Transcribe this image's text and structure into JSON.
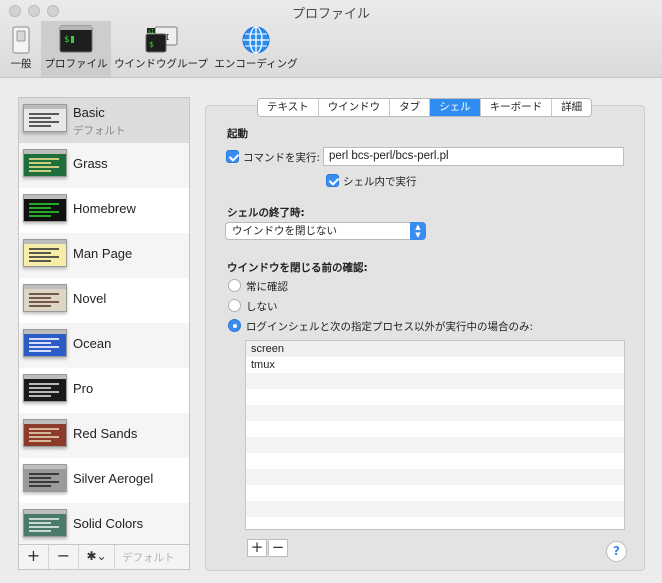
{
  "window": {
    "title": "プロファイル"
  },
  "toolbar": {
    "items": [
      {
        "label": "一般",
        "icon": "switch-icon",
        "selected": false
      },
      {
        "label": "プロファイル",
        "icon": "terminal-icon",
        "selected": true
      },
      {
        "label": "ウインドウグループ",
        "icon": "window-group-icon",
        "selected": false
      },
      {
        "label": "エンコーディング",
        "icon": "globe-icon",
        "selected": false
      }
    ]
  },
  "profiles": {
    "items": [
      {
        "name": "Basic",
        "subtitle": "デフォルト",
        "selected": true,
        "bg": "#e8e8e8",
        "fg": "#333333"
      },
      {
        "name": "Grass",
        "bg": "#1f6f3c",
        "fg": "#f1e38f"
      },
      {
        "name": "Homebrew",
        "bg": "#111111",
        "fg": "#28d02c"
      },
      {
        "name": "Man Page",
        "bg": "#f6eea8",
        "fg": "#333333"
      },
      {
        "name": "Novel",
        "bg": "#ddd6c4",
        "fg": "#5a3a2a"
      },
      {
        "name": "Ocean",
        "bg": "#2c5cc8",
        "fg": "#ffffff"
      },
      {
        "name": "Pro",
        "bg": "#1a1a1a",
        "fg": "#e0e0e0"
      },
      {
        "name": "Red Sands",
        "bg": "#8e3a2a",
        "fg": "#e8d7b0"
      },
      {
        "name": "Silver Aerogel",
        "bg": "#9a9a9a",
        "fg": "#222222"
      },
      {
        "name": "Solid Colors",
        "bg": "#4a7a6a",
        "fg": "#e6f0ea"
      }
    ],
    "footer": {
      "add_label": "+",
      "remove_label": "−",
      "gear_label": "✱⌄",
      "default_label": "デフォルト"
    }
  },
  "tabs": {
    "items": [
      {
        "label": "テキスト",
        "active": false
      },
      {
        "label": "ウインドウ",
        "active": false
      },
      {
        "label": "タブ",
        "active": false
      },
      {
        "label": "シェル",
        "active": true
      },
      {
        "label": "キーボード",
        "active": false
      },
      {
        "label": "詳細",
        "active": false
      }
    ]
  },
  "shell": {
    "startup": {
      "heading": "起動",
      "run_command_label": "コマンドを実行:",
      "run_command_checked": true,
      "command_value": "perl bcs-perl/bcs-perl.pl",
      "run_in_shell_label": "シェル内で実行",
      "run_in_shell_checked": true
    },
    "on_exit": {
      "heading": "シェルの終了時:",
      "selected": "ウインドウを閉じない"
    },
    "confirm": {
      "heading": "ウインドウを閉じる前の確認:",
      "options": [
        {
          "label": "常に確認",
          "selected": false
        },
        {
          "label": "しない",
          "selected": false
        },
        {
          "label": "ログインシェルと次の指定プロセス以外が実行中の場合のみ:",
          "selected": true
        }
      ],
      "processes": [
        "screen",
        "tmux"
      ],
      "add_label": "+",
      "remove_label": "−"
    },
    "help_label": "?"
  },
  "colors": {
    "accent": "#3b8cf0",
    "selection_gray": "#dcdcdc"
  }
}
